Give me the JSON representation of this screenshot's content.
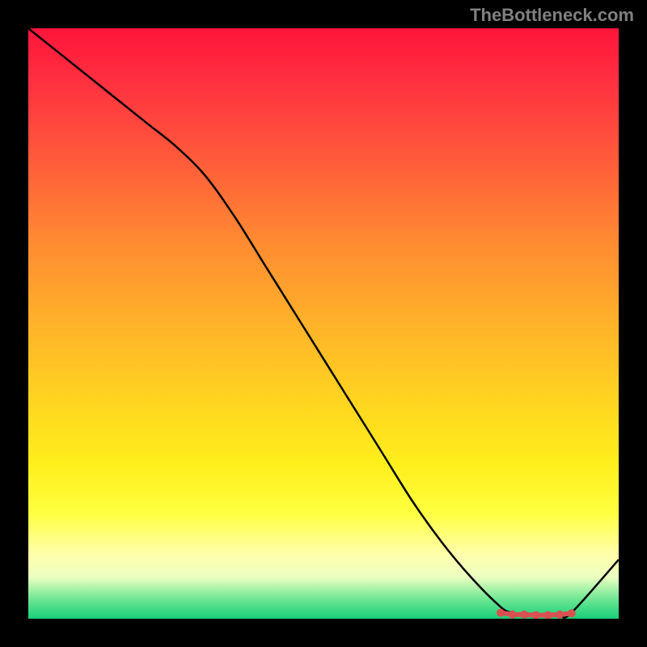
{
  "attribution": "TheBottleneck.com",
  "chart_data": {
    "type": "line",
    "title": "",
    "xlabel": "",
    "ylabel": "",
    "xlim": [
      0,
      100
    ],
    "ylim": [
      0,
      100
    ],
    "x": [
      0,
      5,
      10,
      15,
      20,
      25,
      30,
      35,
      40,
      45,
      50,
      55,
      60,
      65,
      70,
      75,
      80,
      82,
      85,
      88,
      90,
      92,
      100
    ],
    "values": [
      100,
      96,
      92,
      88,
      84,
      80,
      75,
      68,
      60,
      52,
      44,
      36,
      28,
      20,
      13,
      7,
      2,
      1,
      0.5,
      0.5,
      0.5,
      1,
      10
    ],
    "markers": {
      "x": [
        80,
        82,
        84,
        86,
        88,
        90,
        92
      ],
      "values": [
        1,
        0.7,
        0.7,
        0.6,
        0.6,
        0.7,
        0.9
      ],
      "color": "#d85050"
    },
    "gradient_background": {
      "stops": [
        {
          "pos": 0.0,
          "color": "#ff153a"
        },
        {
          "pos": 0.22,
          "color": "#ff5a3a"
        },
        {
          "pos": 0.5,
          "color": "#ffb229"
        },
        {
          "pos": 0.74,
          "color": "#ffef1c"
        },
        {
          "pos": 0.89,
          "color": "#ffffaa"
        },
        {
          "pos": 0.97,
          "color": "#65e490"
        },
        {
          "pos": 1.0,
          "color": "#18cf7a"
        }
      ]
    }
  }
}
